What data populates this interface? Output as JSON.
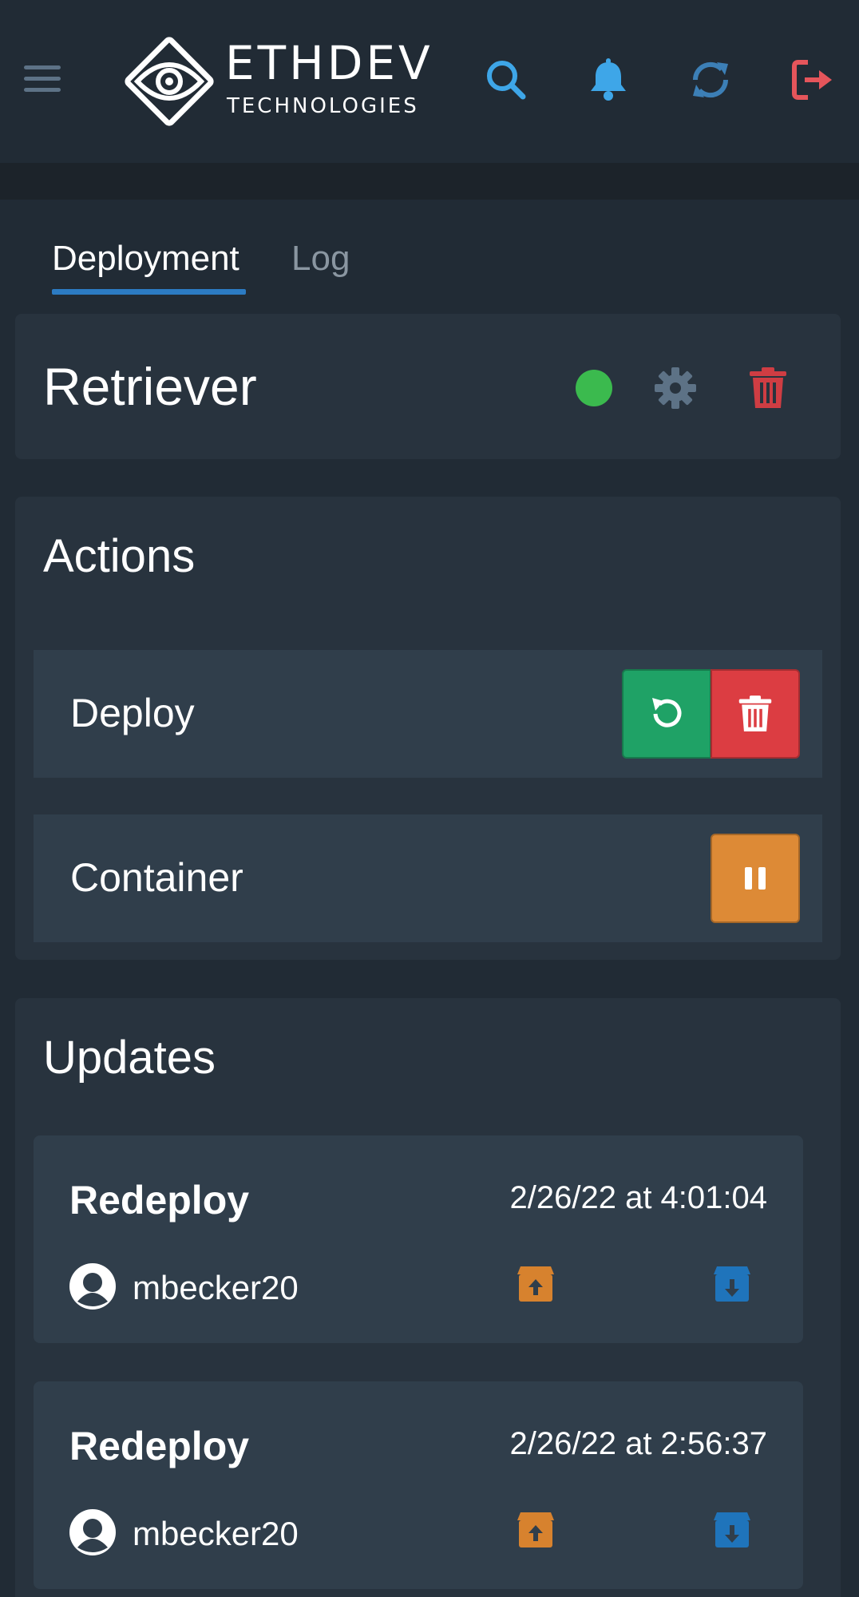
{
  "header": {
    "logo_title": "ETHDEV",
    "logo_subtitle": "TECHNOLOGIES",
    "icons": [
      "menu-icon",
      "search-icon",
      "bell-icon",
      "sync-icon",
      "sign-out-icon"
    ],
    "accent_blue": "#3ea6e8",
    "logout_color": "#e5555b"
  },
  "tabs": [
    {
      "label": "Deployment",
      "active": true
    },
    {
      "label": "Log",
      "active": false
    }
  ],
  "deployment": {
    "name": "Retriever",
    "status_color": "#3bba4e"
  },
  "actions": {
    "title": "Actions",
    "rows": [
      {
        "label": "Deploy",
        "buttons": [
          "redeploy-icon",
          "trash-icon"
        ]
      },
      {
        "label": "Container",
        "buttons": [
          "pause-icon"
        ]
      }
    ]
  },
  "updates": {
    "title": "Updates",
    "items": [
      {
        "type": "Redeploy",
        "time": "2/26/22 at 4:01:04",
        "user": "mbecker20"
      },
      {
        "type": "Redeploy",
        "time": "2/26/22 at 2:56:37",
        "user": "mbecker20"
      }
    ]
  }
}
